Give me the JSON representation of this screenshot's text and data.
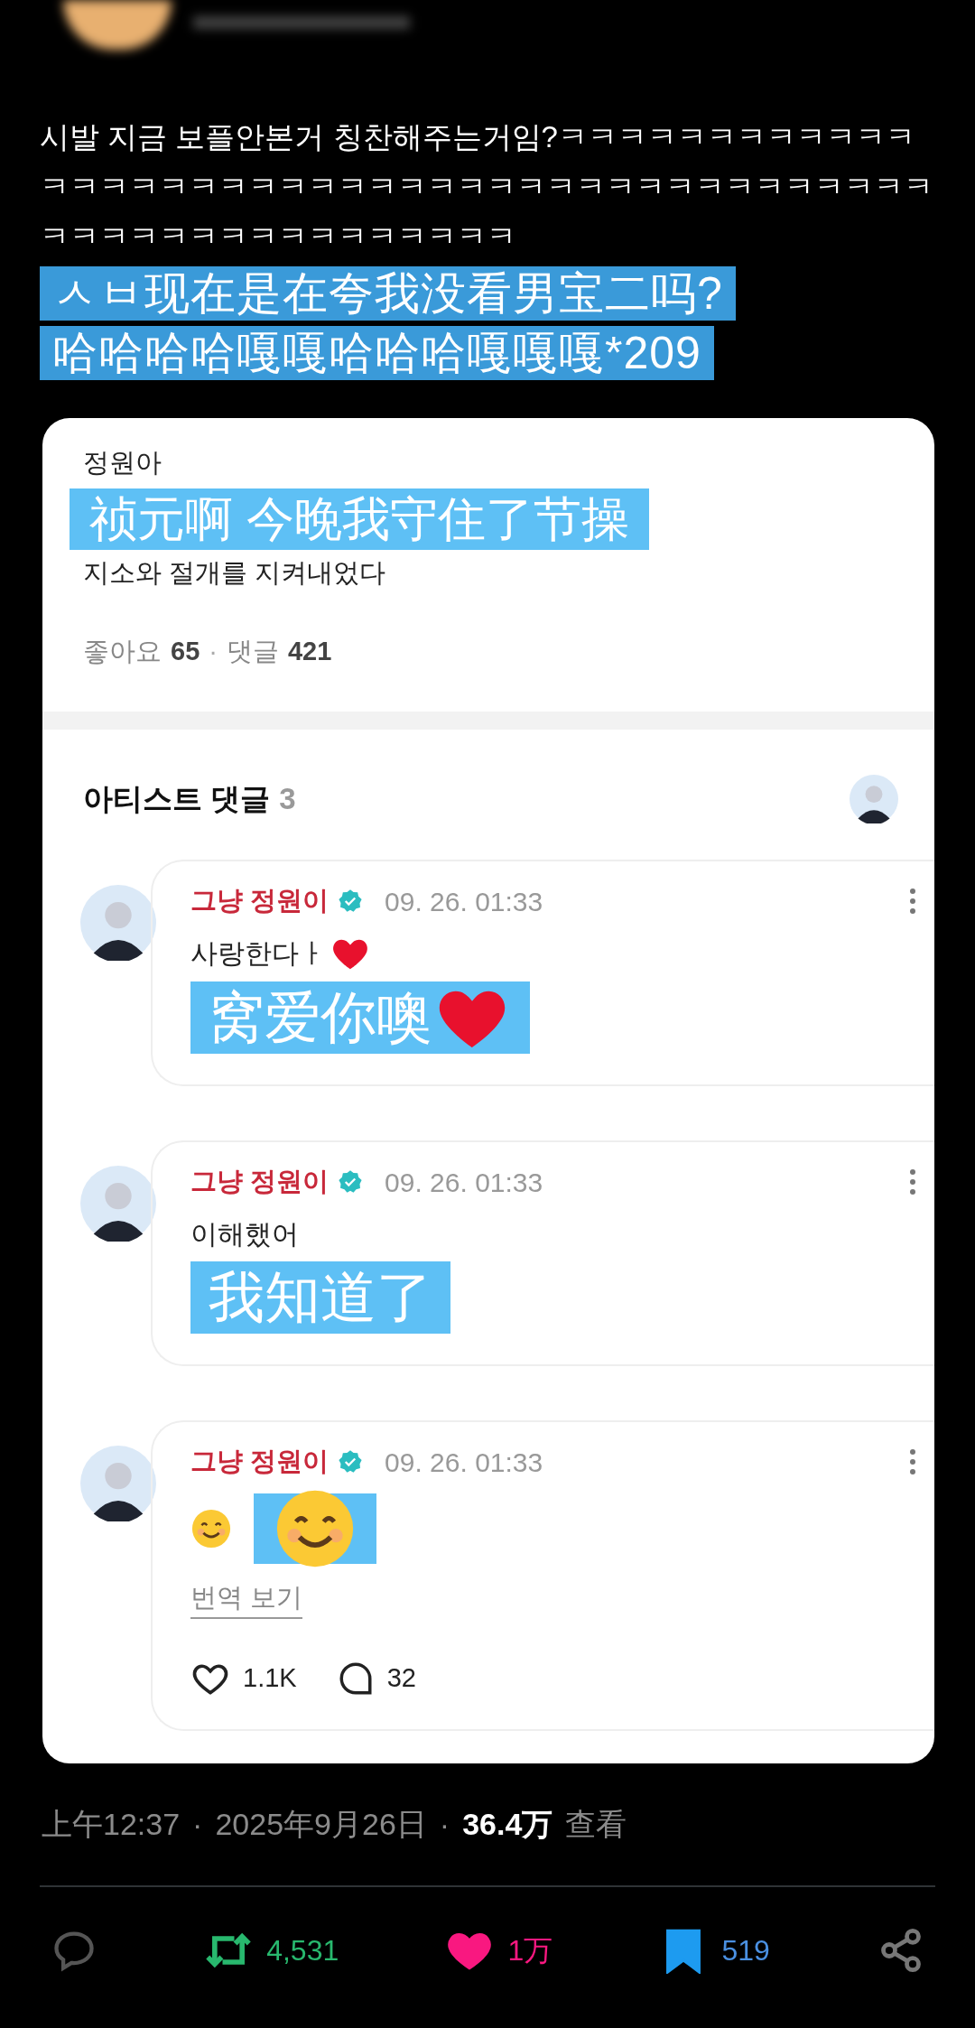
{
  "tweet": {
    "text": "시발 지금 보플안본거 칭찬해주는거임?ㅋㅋㅋㅋㅋㅋㅋㅋㅋㅋㅋㅋㅋㅋㅋㅋㅋㅋㅋㅋㅋㅋㅋㅋㅋㅋㅋㅋㅋㅋㅋㅋㅋㅋㅋㅋㅋㅋㅋㅋㅋㅋㅋㅋㅋㅋㅋㅋㅋㅋㅋㅋㅋㅋㅋㅋㅋㅋ",
    "translation": [
      "ㅅㅂ现在是在夸我没看男宝二吗?",
      "哈哈哈哈嘎嘎哈哈哈嘎嘎嘎*209"
    ]
  },
  "post": {
    "title": "정원아",
    "translation": "祯元啊 今晚我守住了节操",
    "body": "지소와 절개를 지켜내었다",
    "stats": [
      {
        "label": "좋아요",
        "value": "65"
      },
      {
        "label": "댓글",
        "value": "421"
      }
    ],
    "separator": "·"
  },
  "artist_comments": {
    "title": "아티스트 댓글",
    "count": "3",
    "comments": [
      {
        "author": "그냥 정원이",
        "verified": true,
        "time": "09. 26. 01:33",
        "content": [
          {
            "kind": "text",
            "text": "사랑한다ㅏ"
          },
          {
            "kind": "heart"
          }
        ],
        "translation": [
          {
            "kind": "text",
            "text": "窝爱你噢"
          },
          {
            "kind": "heart"
          }
        ]
      },
      {
        "author": "그냥 정원이",
        "verified": true,
        "time": "09. 26. 01:33",
        "content": [
          {
            "kind": "text",
            "text": "이해했어"
          }
        ],
        "translation": [
          {
            "kind": "text",
            "text": "我知道了"
          }
        ]
      },
      {
        "author": "그냥 정원이",
        "verified": true,
        "time": "09. 26. 01:33",
        "content": [
          {
            "kind": "smile"
          }
        ],
        "translation": [
          {
            "kind": "smile"
          }
        ],
        "link": "번역 보기",
        "likes": "1.1K",
        "replies": "32"
      }
    ]
  },
  "meta": {
    "time": "上午12:37",
    "date": "2025年9月26日",
    "views": "36.4万",
    "views_label": "查看",
    "separator": "·"
  },
  "actions": [
    {
      "kind": "reply",
      "active": false
    },
    {
      "kind": "retweet",
      "count": "4,531",
      "active": true
    },
    {
      "kind": "like",
      "count": "1万",
      "active": true
    },
    {
      "kind": "bookmark",
      "count": "519",
      "active": true
    },
    {
      "kind": "share",
      "active": false
    }
  ]
}
